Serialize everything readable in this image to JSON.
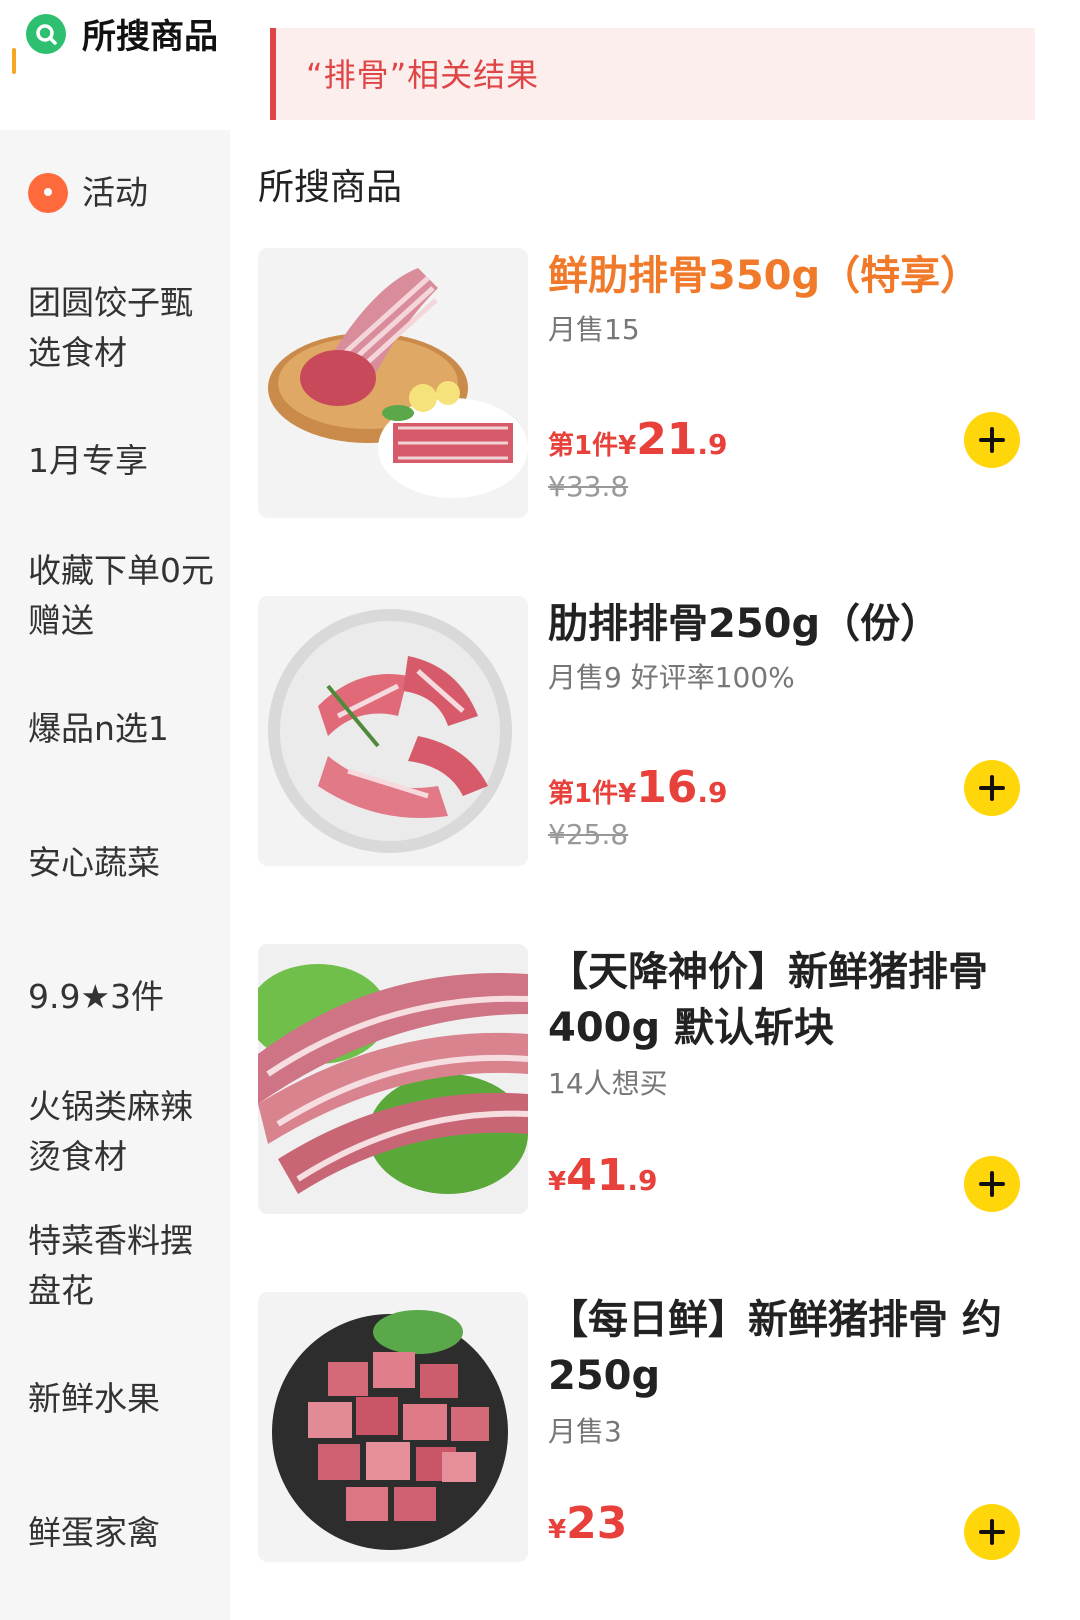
{
  "sidebar": {
    "active": {
      "label": "所搜商品",
      "icon": "search-icon"
    },
    "items": [
      {
        "label": "活动",
        "icon": "location-icon"
      },
      {
        "label": "团圆饺子甄选食材"
      },
      {
        "label": "1月专享"
      },
      {
        "label": "收藏下单0元赠送"
      },
      {
        "label": "爆品n选1"
      },
      {
        "label": "安心蔬菜"
      },
      {
        "label": "9.9★3件"
      },
      {
        "label": "火锅类麻辣烫食材"
      },
      {
        "label": "特菜香料摆盘花"
      },
      {
        "label": "新鲜水果"
      },
      {
        "label": "鲜蛋家禽"
      }
    ]
  },
  "banner": {
    "text": "“排骨”相关结果"
  },
  "section_title": "所搜商品",
  "products": [
    {
      "title": "鲜肋排骨350g（特享）",
      "sub": "月售15",
      "price_prefix": "第1件¥",
      "price_int": "21",
      "price_dec": ".9",
      "orig_price": "¥33.8"
    },
    {
      "title": "肋排排骨250g（份）",
      "sub": "月售9  好评率100%",
      "price_prefix": "第1件¥",
      "price_int": "16",
      "price_dec": ".9",
      "orig_price": "¥25.8"
    },
    {
      "title": "【天降神价】新鲜猪排骨400g 默认斩块",
      "sub": "14人想买",
      "price_prefix": "¥",
      "price_int": "41",
      "price_dec": ".9",
      "orig_price": ""
    },
    {
      "title": "【每日鲜】新鲜猪排骨 约250g",
      "sub": "月售3",
      "price_prefix": "¥",
      "price_int": "23",
      "price_dec": "",
      "orig_price": ""
    }
  ],
  "colors": {
    "accent_red": "#e04545",
    "orange": "#f07a2a",
    "yellow": "#ffd60a",
    "green": "#2fbf71"
  }
}
